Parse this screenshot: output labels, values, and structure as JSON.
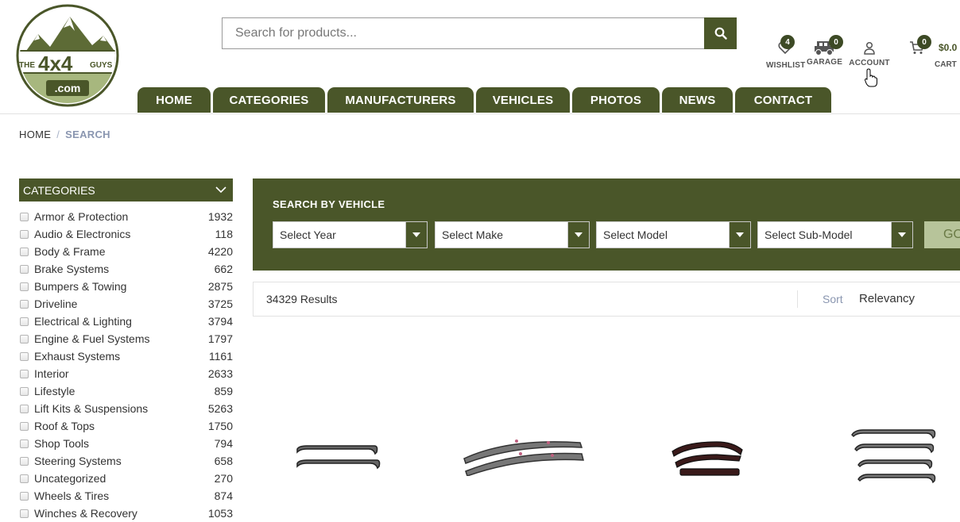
{
  "logo": {
    "line1": "THE",
    "brand": "4x4",
    "line2": "GUYS",
    "domain": ".com"
  },
  "search": {
    "placeholder": "Search for products..."
  },
  "header": {
    "wishlist": {
      "label": "WISHLIST",
      "count": "4"
    },
    "garage": {
      "label": "GARAGE",
      "count": "0"
    },
    "account": {
      "label": "ACCOUNT"
    },
    "cart": {
      "label": "CART",
      "count": "0",
      "total": "$0.0"
    }
  },
  "nav": [
    "HOME",
    "CATEGORIES",
    "MANUFACTURERS",
    "VEHICLES",
    "PHOTOS",
    "NEWS",
    "CONTACT"
  ],
  "breadcrumb": {
    "home": "HOME",
    "sep": "/",
    "current": "SEARCH"
  },
  "sidebar": {
    "title": "CATEGORIES",
    "items": [
      {
        "name": "Armor & Protection",
        "count": "1932"
      },
      {
        "name": "Audio & Electronics",
        "count": "118"
      },
      {
        "name": "Body & Frame",
        "count": "4220"
      },
      {
        "name": "Brake Systems",
        "count": "662"
      },
      {
        "name": "Bumpers & Towing",
        "count": "2875"
      },
      {
        "name": "Driveline",
        "count": "3725"
      },
      {
        "name": "Electrical & Lighting",
        "count": "3794"
      },
      {
        "name": "Engine & Fuel Systems",
        "count": "1797"
      },
      {
        "name": "Exhaust Systems",
        "count": "1161"
      },
      {
        "name": "Interior",
        "count": "2633"
      },
      {
        "name": "Lifestyle",
        "count": "859"
      },
      {
        "name": "Lift Kits & Suspensions",
        "count": "5263"
      },
      {
        "name": "Roof & Tops",
        "count": "1750"
      },
      {
        "name": "Shop Tools",
        "count": "794"
      },
      {
        "name": "Steering Systems",
        "count": "658"
      },
      {
        "name": "Uncategorized",
        "count": "270"
      },
      {
        "name": "Wheels & Tires",
        "count": "874"
      },
      {
        "name": "Winches & Recovery",
        "count": "1053"
      }
    ]
  },
  "vehicle": {
    "title": "SEARCH BY VEHICLE",
    "selects": [
      "Select Year",
      "Select Make",
      "Select Model",
      "Select Sub-Model"
    ],
    "go": "GO"
  },
  "results": {
    "count": "34329 Results",
    "sort_label": "Sort",
    "sort_value": "Relevancy"
  },
  "colors": {
    "brand_green": "#4a5629",
    "go_button": "#b7c49a"
  }
}
